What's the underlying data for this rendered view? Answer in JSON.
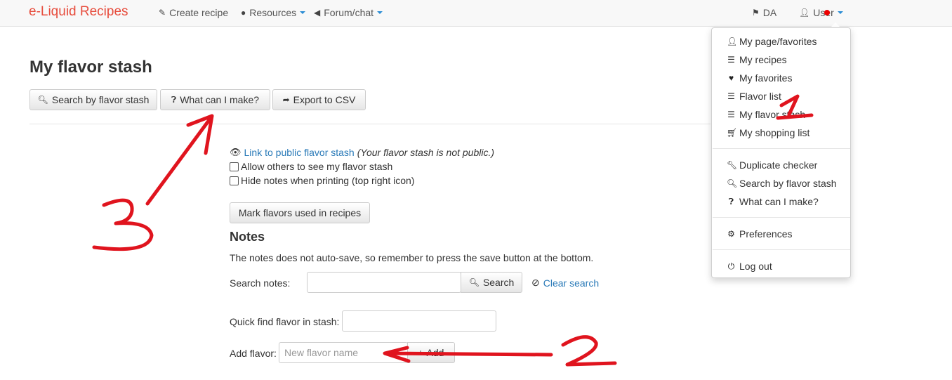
{
  "navbar": {
    "brand": "e-Liquid Recipes",
    "create_recipe": "Create recipe",
    "resources": "Resources",
    "forum": "Forum/chat",
    "language": "DA",
    "user": "User"
  },
  "page": {
    "title": "My flavor stash",
    "buttons": {
      "search_by_stash": "Search by flavor stash",
      "what_can_i_make": "What can I make?",
      "export_csv": "Export to CSV"
    },
    "public_link": "Link to public flavor stash",
    "public_status": "(Your flavor stash is not public.)",
    "allow_others": "Allow others to see my flavor stash",
    "hide_notes": "Hide notes when printing (top right icon)",
    "mark_flavors": "Mark flavors used in recipes",
    "notes_heading": "Notes",
    "notes_hint": "The notes does not auto-save, so remember to press the save button at the bottom.",
    "search_notes_label": "Search notes:",
    "search_button": "Search",
    "clear_search": "Clear search",
    "quick_find_label": "Quick find flavor in stash:",
    "add_flavor_label": "Add flavor:",
    "add_flavor_placeholder": "New flavor name",
    "add_button": "Add"
  },
  "user_menu": {
    "items": [
      {
        "label": "My page/favorites",
        "icon": "user-icon"
      },
      {
        "label": "My recipes",
        "icon": "list-icon"
      },
      {
        "label": "My favorites",
        "icon": "heart-icon"
      },
      {
        "label": "Flavor list",
        "icon": "list-icon"
      },
      {
        "label": "My flavor stash",
        "icon": "list-icon"
      },
      {
        "label": "My shopping list",
        "icon": "cart-icon"
      },
      {
        "label": "Duplicate checker",
        "icon": "wrench-icon"
      },
      {
        "label": "Search by flavor stash",
        "icon": "search-icon"
      },
      {
        "label": "What can I make?",
        "icon": "question-icon"
      },
      {
        "label": "Preferences",
        "icon": "gear-icon"
      },
      {
        "label": "Log out",
        "icon": "power-icon"
      }
    ]
  },
  "annotations": {
    "label_1": "1",
    "label_2": "2",
    "label_3": "3"
  },
  "colors": {
    "brand": "#e74c3c",
    "link": "#2a7ab8",
    "annotation": "#e0141e"
  }
}
